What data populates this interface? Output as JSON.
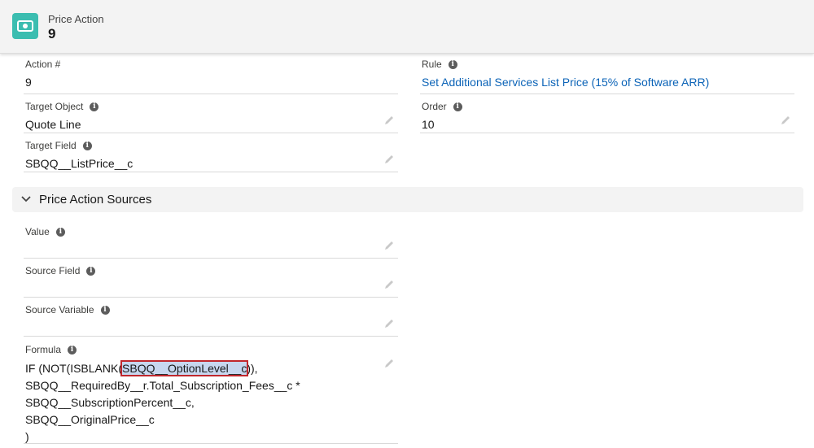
{
  "header": {
    "object_label": "Price Action",
    "record_title": "9",
    "icon": "price-action-icon",
    "icon_color": "#3bbdb0"
  },
  "fields": {
    "action_number": {
      "label": "Action #",
      "value": "9"
    },
    "rule": {
      "label": "Rule",
      "value": "Set Additional Services List Price (15% of Software ARR)"
    },
    "target_object": {
      "label": "Target Object",
      "value": "Quote Line"
    },
    "order": {
      "label": "Order",
      "value": "10"
    },
    "target_field": {
      "label": "Target Field",
      "value": "SBQQ__ListPrice__c"
    }
  },
  "section": {
    "title": "Price Action Sources",
    "expanded": true
  },
  "sources": {
    "value": {
      "label": "Value",
      "value": ""
    },
    "source_field": {
      "label": "Source Field",
      "value": ""
    },
    "source_variable": {
      "label": "Source Variable",
      "value": ""
    },
    "formula": {
      "label": "Formula",
      "line1_prefix": "IF (NOT(ISBLANK(",
      "line1_highlight": "SBQQ__OptionLevel__c",
      "line1_suffix": ")),",
      "line2": "SBQQ__RequiredBy__r.Total_Subscription_Fees__c *",
      "line3": "SBQQ__SubscriptionPercent__c,",
      "line4": "SBQQ__OriginalPrice__c",
      "line5": ")"
    }
  },
  "colors": {
    "link": "#0b63b7",
    "highlight_box": "#c0272d",
    "selection": "#c7d7ef"
  }
}
